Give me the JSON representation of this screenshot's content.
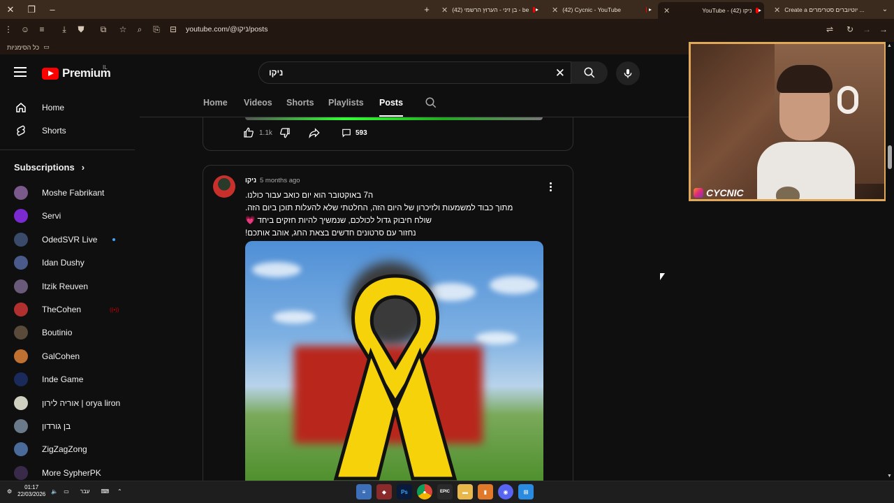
{
  "browser": {
    "tabs": [
      {
        "title": "Create a יוטיוברים סטרימרים ...",
        "active": false
      },
      {
        "title": "YouTube - ניקו (42)",
        "active": true
      },
      {
        "title": "(42) Cycnic - YouTube",
        "active": false
      },
      {
        "title": "(42) בן זיני - הערוץ הרשמי - be",
        "active": false
      }
    ],
    "url": "youtube.com/@ניקו/posts",
    "bookmarks_label": "כל הסימניות"
  },
  "masthead": {
    "logo_text": "Premium",
    "country_code": "IL",
    "search_value": "ניקו"
  },
  "sidebar": {
    "nav": [
      {
        "label": "Home",
        "icon": "home-icon"
      },
      {
        "label": "Shorts",
        "icon": "shorts-icon"
      }
    ],
    "subscriptions_label": "Subscriptions",
    "subscriptions": [
      {
        "name": "Moshe Fabrikant",
        "color": "#7a5a8a",
        "status": ""
      },
      {
        "name": "Servi",
        "color": "#7a2ad0",
        "status": ""
      },
      {
        "name": "OdedSVR Live",
        "color": "#3a4a6a",
        "status": "dot"
      },
      {
        "name": "Idan Dushy",
        "color": "#4a5a8a",
        "status": ""
      },
      {
        "name": "Itzik Reuven",
        "color": "#6a5a7a",
        "status": ""
      },
      {
        "name": "TheCohen",
        "color": "#b03030",
        "status": "live"
      },
      {
        "name": "Boutinio",
        "color": "#5a4a3a",
        "status": ""
      },
      {
        "name": "GalCohen",
        "color": "#c07030",
        "status": ""
      },
      {
        "name": "Inde Game",
        "color": "#1a2a5a",
        "status": ""
      },
      {
        "name": "אוריה לירון | orya liron",
        "color": "#d0d0c0",
        "status": ""
      },
      {
        "name": "בן גורדון",
        "color": "#6a7a8a",
        "status": ""
      },
      {
        "name": "ZigZagZong",
        "color": "#4a6a9a",
        "status": ""
      },
      {
        "name": "More SypherPK",
        "color": "#3a2a4a",
        "status": ""
      }
    ],
    "live_badge": "((•))"
  },
  "channel_tabs": {
    "items": [
      "Home",
      "Videos",
      "Shorts",
      "Playlists",
      "Posts"
    ],
    "active": "Posts"
  },
  "previous_post": {
    "likes": "1.1k",
    "comments": "593"
  },
  "post": {
    "author": "ניקו",
    "time": "5 months ago",
    "lines": [
      "ה7 באוקטובר הוא יום כואב עבור כולנו.",
      "מתוך כבוד למשמעות ולזיכרון של היום הזה, החלטתי שלא להעלות תוכן ביום הזה.",
      "שולח חיבוק גדול לכולכם, שנמשיך להיות חזקים ביחד 💗",
      "נחזור עם סרטונים חדשים בצאת החג, אוהב אותכם!"
    ]
  },
  "webcam": {
    "streamer_name": "CYCNIC"
  },
  "taskbar": {
    "time": "01:17",
    "date": "22/03/2026",
    "language": "עבר"
  },
  "colors": {
    "accent_red": "#ff0000",
    "ribbon_yellow": "#f5d20a",
    "webcam_border": "#e0a85a"
  }
}
